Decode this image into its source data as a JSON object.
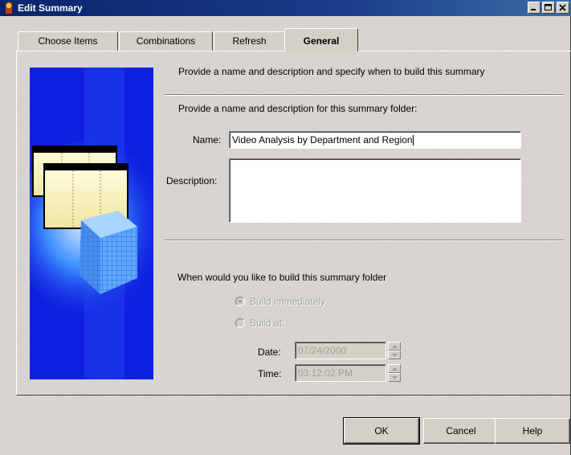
{
  "window": {
    "title": "Edit Summary"
  },
  "tabs": [
    {
      "label": "Choose Items"
    },
    {
      "label": "Combinations"
    },
    {
      "label": "Refresh"
    },
    {
      "label": "General",
      "active": true
    }
  ],
  "general": {
    "intro": "Provide a name and description and specify when to build this summary",
    "section_label": "Provide a name and description for this summary folder:",
    "name_label": "Name:",
    "name_value": "Video Analysis by Department and Region",
    "description_label": "Description:",
    "description_value": "",
    "build_question": "When would you like to build this summary folder",
    "build_immediately_label": "Build immediately",
    "build_at_label": "Build at:",
    "build_immediately_selected": true,
    "date_label": "Date:",
    "date_value": "07/24/2000",
    "time_label": "Time:",
    "time_value": "03:12:02 PM"
  },
  "buttons": {
    "ok": "OK",
    "cancel": "Cancel",
    "help": "Help"
  },
  "icons": [
    "wizard-icon",
    "minimize-icon",
    "maximize-icon",
    "close-icon",
    "spin-up-icon",
    "spin-down-icon"
  ],
  "colors": {
    "titlebar": "#0a246a",
    "dialog_face": "#d4d0c8",
    "art_blue": "#1020e0"
  }
}
